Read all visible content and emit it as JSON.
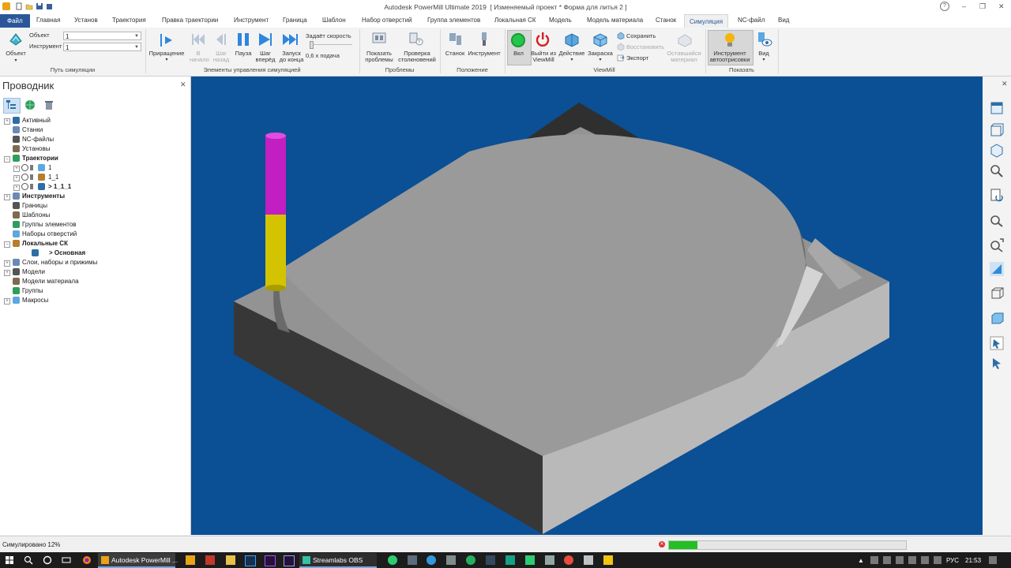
{
  "window": {
    "title": "Autodesk PowerMill Ultimate 2019",
    "project": "[ Изменяемый проект * Форма для литья 2 ]",
    "help_icon": "question-icon",
    "controls": [
      "–",
      "❐",
      "✕"
    ]
  },
  "tabs": [
    {
      "label": "Файл",
      "kind": "file"
    },
    {
      "label": "Главная"
    },
    {
      "label": "Установ"
    },
    {
      "label": "Траектория"
    },
    {
      "label": "Правка траектории"
    },
    {
      "label": "Инструмент"
    },
    {
      "label": "Граница"
    },
    {
      "label": "Шаблон"
    },
    {
      "label": "Набор отверстий"
    },
    {
      "label": "Группа элементов"
    },
    {
      "label": "Локальная СК"
    },
    {
      "label": "Модель"
    },
    {
      "label": "Модель материала"
    },
    {
      "label": "Станок"
    },
    {
      "label": "Симуляция",
      "kind": "active"
    },
    {
      "label": "NC-файл"
    },
    {
      "label": "Вид"
    }
  ],
  "ribbon": {
    "path_group": {
      "label": "Путь симуляции",
      "object_button": "Объект",
      "object_label": "Объект",
      "object_value": "1",
      "tool_label": "Инструмент",
      "tool_value": "1"
    },
    "controls_group": {
      "label": "Элементы управления симуляцией",
      "increment": "Приращение",
      "to_start": "В начало",
      "step_back": "Шаг назад",
      "pause": "Пауза",
      "step_forward": "Шаг вперёд",
      "run_to_end": "Запуск до конца",
      "speed_label": "Задаёт скорость",
      "feed_label": "0,6 x подача"
    },
    "problems_group": {
      "label": "Проблемы",
      "show_problems": "Показать проблемы",
      "collision_check": "Проверка столкновений"
    },
    "position_group": {
      "label": "Положение",
      "machine": "Станок",
      "tool": "Инструмент"
    },
    "viewmill_group": {
      "label": "ViewMill",
      "on": "Вкл",
      "exit": "Выйти из ViewMill",
      "action": "Действие",
      "shading": "Закраска",
      "save": "Сохранить",
      "restore": "Восстановить",
      "export": "Экспорт",
      "remaining": "Оставшийся материал"
    },
    "show_group": {
      "label": "Показать",
      "auto_tool": "Инструмент автоотрисовки",
      "view": "Вид"
    }
  },
  "explorer": {
    "title": "Проводник",
    "items": [
      {
        "label": "Активный",
        "level": 0,
        "bold": false,
        "expander": "+"
      },
      {
        "label": "Станки",
        "level": 0,
        "bold": false,
        "expander": ""
      },
      {
        "label": "NC-файлы",
        "level": 0,
        "bold": false,
        "expander": ""
      },
      {
        "label": "Установы",
        "level": 0,
        "bold": false,
        "expander": ""
      },
      {
        "label": "Траектории",
        "level": 0,
        "bold": true,
        "expander": "–"
      },
      {
        "label": "1",
        "level": 1,
        "bold": false,
        "expander": "+"
      },
      {
        "label": "1_1",
        "level": 1,
        "bold": false,
        "expander": "+"
      },
      {
        "label": "> 1_1_1",
        "level": 1,
        "bold": true,
        "expander": "+"
      },
      {
        "label": "Инструменты",
        "level": 0,
        "bold": true,
        "expander": "+"
      },
      {
        "label": "Границы",
        "level": 0,
        "bold": false,
        "expander": ""
      },
      {
        "label": "Шаблоны",
        "level": 0,
        "bold": false,
        "expander": ""
      },
      {
        "label": "Группы элементов",
        "level": 0,
        "bold": false,
        "expander": ""
      },
      {
        "label": "Наборы отверстий",
        "level": 0,
        "bold": false,
        "expander": ""
      },
      {
        "label": "Локальные СК",
        "level": 0,
        "bold": true,
        "expander": "–"
      },
      {
        "label": "> Основная",
        "level": 2,
        "bold": true,
        "expander": ""
      },
      {
        "label": "Слои, наборы и прижимы",
        "level": 0,
        "bold": false,
        "expander": "+"
      },
      {
        "label": "Модели",
        "level": 0,
        "bold": false,
        "expander": "+"
      },
      {
        "label": "Модели материала",
        "level": 0,
        "bold": false,
        "expander": ""
      },
      {
        "label": "Группы",
        "level": 0,
        "bold": false,
        "expander": ""
      },
      {
        "label": "Макросы",
        "level": 0,
        "bold": false,
        "expander": "+"
      }
    ]
  },
  "status": {
    "text": "Симулировано 12%",
    "progress": 0.12
  },
  "taskbar": {
    "powermill": "Autodesk PowerMill ...",
    "obs": "Streamlabs OBS",
    "lang": "РУС",
    "time": "21:53"
  },
  "colors": {
    "viewport_bg": "#0b4f95",
    "tool_holder": "#c21fc2",
    "tool_cutter": "#d3c300",
    "accent": "#2b579a",
    "progress": "#22c022"
  }
}
